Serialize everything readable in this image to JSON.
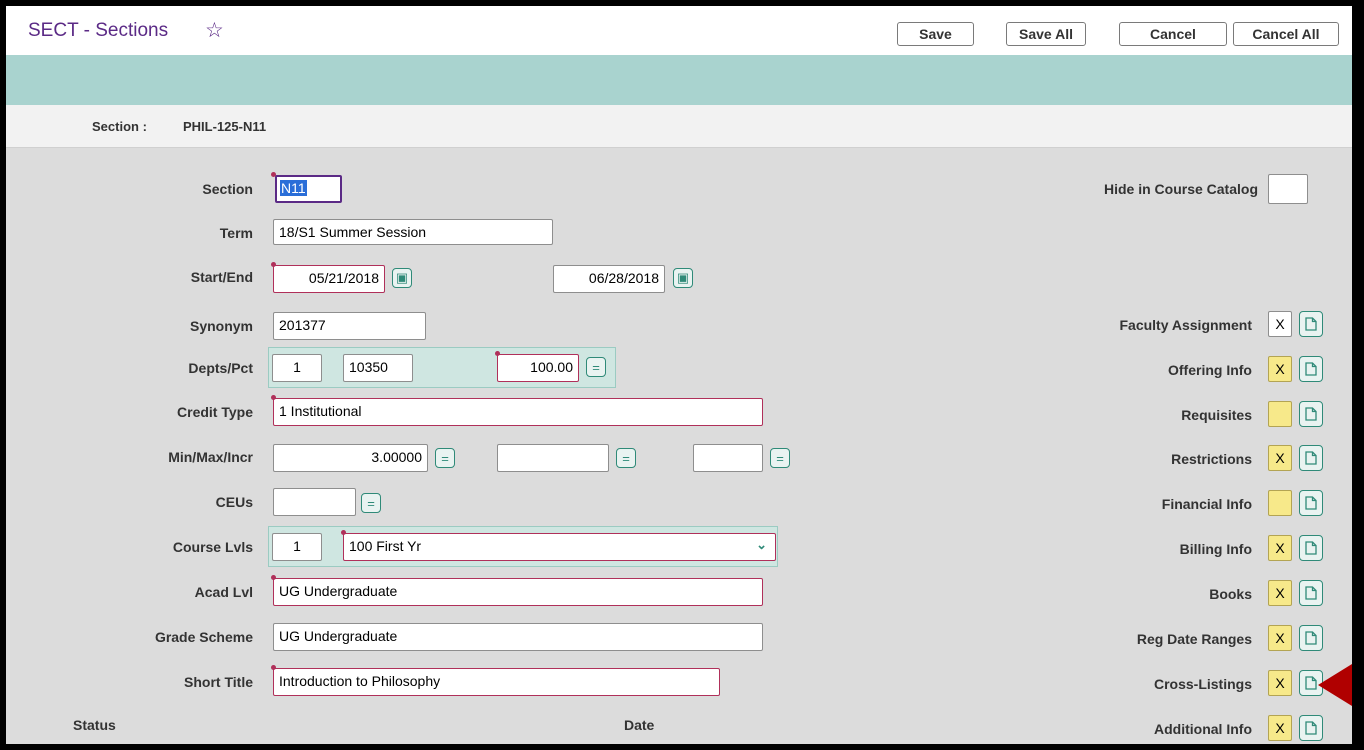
{
  "header": {
    "title": "SECT - Sections",
    "buttons": {
      "save": "Save",
      "save_all": "Save All",
      "cancel": "Cancel",
      "cancel_all": "Cancel All"
    }
  },
  "context": {
    "label": "Section :",
    "value": "PHIL-125-N11"
  },
  "form": {
    "section": {
      "label": "Section",
      "value": "N11"
    },
    "term": {
      "label": "Term",
      "value": "18/S1 Summer Session"
    },
    "start_end": {
      "label": "Start/End",
      "start": "05/21/2018",
      "end": "06/28/2018"
    },
    "synonym": {
      "label": "Synonym",
      "value": "201377"
    },
    "depts_pct": {
      "label": "Depts/Pct",
      "index": "1",
      "dept": "10350",
      "pct": "100.00"
    },
    "credit_type": {
      "label": "Credit Type",
      "value": "1 Institutional"
    },
    "min_max_incr": {
      "label": "Min/Max/Incr",
      "min": "3.00000",
      "max": "",
      "incr": ""
    },
    "ceus": {
      "label": "CEUs",
      "value": ""
    },
    "course_lvls": {
      "label": "Course Lvls",
      "index": "1",
      "value": "100 First Yr"
    },
    "acad_lvl": {
      "label": "Acad Lvl",
      "value": "UG Undergraduate"
    },
    "grade_scheme": {
      "label": "Grade Scheme",
      "value": "UG Undergraduate"
    },
    "short_title": {
      "label": "Short Title",
      "value": "Introduction to Philosophy"
    },
    "status_label": "Status",
    "date_label": "Date"
  },
  "right_panel": {
    "hide_catalog": {
      "label": "Hide in Course Catalog",
      "value": ""
    },
    "items": [
      {
        "label": "Faculty Assignment",
        "value": "X",
        "yellow": false
      },
      {
        "label": "Offering Info",
        "value": "X",
        "yellow": true
      },
      {
        "label": "Requisites",
        "value": "",
        "yellow": true
      },
      {
        "label": "Restrictions",
        "value": "X",
        "yellow": true
      },
      {
        "label": "Financial Info",
        "value": "",
        "yellow": true
      },
      {
        "label": "Billing Info",
        "value": "X",
        "yellow": true
      },
      {
        "label": "Books",
        "value": "X",
        "yellow": true
      },
      {
        "label": "Reg Date Ranges",
        "value": "X",
        "yellow": true
      },
      {
        "label": "Cross-Listings",
        "value": "X",
        "yellow": true
      },
      {
        "label": "Additional Info",
        "value": "X",
        "yellow": true
      }
    ]
  },
  "colors": {
    "title": "#5b2a86",
    "teal": "#a9d3cf",
    "required": "#b0305a",
    "flag": "#f7e98a",
    "arrow": "#b00000"
  },
  "icons": [
    "star-icon",
    "calendar-icon",
    "equals-icon",
    "chevron-down-icon",
    "document-icon"
  ]
}
